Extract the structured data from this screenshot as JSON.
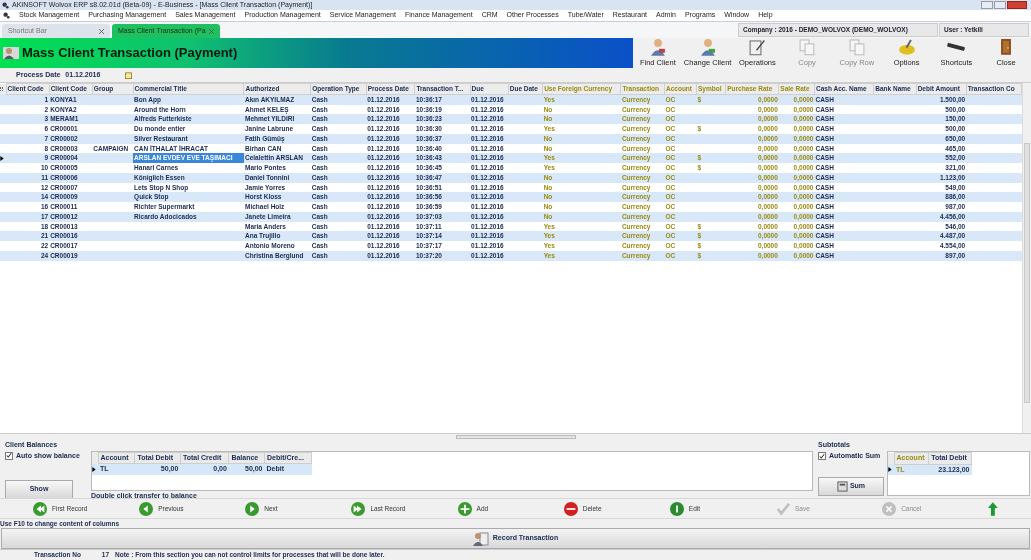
{
  "window": {
    "title": "AKINSOFT Wolvox ERP s8.02.01d (Beta-09) - E-Business - [Mass Client Transaction (Payment)]"
  },
  "menu": [
    "Stock Management",
    "Purchasing Management",
    "Sales Management",
    "Production Management",
    "Service Management",
    "Finance Management",
    "CRM",
    "Other Processes",
    "Tube/Water",
    "Restaurant",
    "Admin",
    "Programs",
    "Window",
    "Help"
  ],
  "tabs": [
    {
      "label": "Shortcut Bar",
      "selected": false
    },
    {
      "label": "Mass Client Transaction (Pa",
      "selected": true
    }
  ],
  "company": "Company : 2016 - DEMO_WOLVOX (DEMO_WOLVOX)",
  "user": "User : Yetkili",
  "form_title": "Mass Client Transaction (Payment)",
  "toolbar": [
    {
      "label": "Find Client",
      "kind": "find",
      "disabled": false
    },
    {
      "label": "Change Client",
      "kind": "change",
      "disabled": false
    },
    {
      "label": "Operations",
      "kind": "operations",
      "disabled": false
    },
    {
      "label": "Copy",
      "kind": "copy",
      "disabled": true
    },
    {
      "label": "Copy Row",
      "kind": "copyrow",
      "disabled": true
    },
    {
      "label": "Options",
      "kind": "options",
      "disabled": false
    },
    {
      "label": "Shortcuts",
      "kind": "shortcuts",
      "disabled": false
    },
    {
      "label": "Close",
      "kind": "close",
      "disabled": false
    }
  ],
  "process_date": {
    "label": "Process Date",
    "value": "01.12.2016"
  },
  "table": {
    "columns": [
      {
        "label": "Client Code",
        "highlighted": false
      },
      {
        "label": "Client Code",
        "highlighted": false
      },
      {
        "label": "Group",
        "highlighted": false
      },
      {
        "label": "Commercial Title",
        "highlighted": false
      },
      {
        "label": "Authorized",
        "highlighted": false
      },
      {
        "label": "Operation Type",
        "highlighted": false
      },
      {
        "label": "Process Date",
        "highlighted": false
      },
      {
        "label": "Transaction T...",
        "highlighted": false
      },
      {
        "label": "Due",
        "highlighted": false
      },
      {
        "label": "Due Date",
        "highlighted": false
      },
      {
        "label": "Use Foreign Currency",
        "highlighted": true
      },
      {
        "label": "Transaction",
        "highlighted": true
      },
      {
        "label": "Account",
        "highlighted": true
      },
      {
        "label": "Symbol",
        "highlighted": true
      },
      {
        "label": "Purchase Rate",
        "highlighted": true
      },
      {
        "label": "Sale Rate",
        "highlighted": true
      },
      {
        "label": "Cash Acc. Name",
        "highlighted": false
      },
      {
        "label": "Bank Name",
        "highlighted": false
      },
      {
        "label": "Debit Amount",
        "highlighted": false
      },
      {
        "label": "Transaction Co",
        "highlighted": false
      }
    ],
    "rows": [
      {
        "selected": false,
        "cells": [
          "1",
          "KONYA1",
          null,
          "Bon App",
          "Akın AKYILMAZ",
          "Cash",
          "01.12.2016",
          "10:36:17",
          "01.12.2016",
          null,
          "Yes",
          "Currency",
          "OC",
          "$",
          "0,0000",
          "0,0000",
          "CASH",
          null,
          "1.500,00",
          null
        ]
      },
      {
        "selected": false,
        "cells": [
          "2",
          "KONYA2",
          null,
          "Around the Horn",
          "Ahmet KELEŞ",
          "Cash",
          "01.12.2016",
          "10:36:19",
          "01.12.2016",
          null,
          "No",
          "Currency",
          "OC",
          null,
          "0,0000",
          "0,0000",
          "CASH",
          null,
          "500,00",
          null
        ]
      },
      {
        "selected": false,
        "cells": [
          "3",
          "MERAM1",
          null,
          "Alfreds Futterkiste",
          "Mehmet YILDIRI",
          "Cash",
          "01.12.2016",
          "10:36:23",
          "01.12.2016",
          null,
          "No",
          "Currency",
          "OC",
          null,
          "0,0000",
          "0,0000",
          "CASH",
          null,
          "150,00",
          null
        ]
      },
      {
        "selected": false,
        "cells": [
          "6",
          "CR00001",
          null,
          "Du monde entier",
          "Janine Labrune",
          "Cash",
          "01.12.2016",
          "10:36:30",
          "01.12.2016",
          null,
          "Yes",
          "Currency",
          "OC",
          "$",
          "0,0000",
          "0,0000",
          "CASH",
          null,
          "500,00",
          null
        ]
      },
      {
        "selected": false,
        "cells": [
          "7",
          "CR00002",
          null,
          "Silver Restaurant",
          "Fatih Gümüş",
          "Cash",
          "01.12.2016",
          "10:36:37",
          "01.12.2016",
          null,
          "No",
          "Currency",
          "OC",
          null,
          "0,0000",
          "0,0000",
          "CASH",
          null,
          "650,00",
          null
        ]
      },
      {
        "selected": false,
        "cells": [
          "8",
          "CR00003",
          "CAMPAIGN",
          "CAN İTHALAT İHRACAT",
          "Birhan CAN",
          "Cash",
          "01.12.2016",
          "10:36:40",
          "01.12.2016",
          null,
          "No",
          "Currency",
          "OC",
          null,
          "0,0000",
          "0,0000",
          "CASH",
          null,
          "465,00",
          null
        ]
      },
      {
        "selected": true,
        "cells": [
          "9",
          "CR00004",
          null,
          "ARSLAN EVDEV EVE TAŞIMACI",
          "Celalettin ARSLAN",
          "Cash",
          "01.12.2016",
          "10:36:43",
          "01.12.2016",
          null,
          "Yes",
          "Currency",
          "OC",
          "$",
          "0,0000",
          "0,0000",
          "CASH",
          null,
          "552,00",
          null
        ]
      },
      {
        "selected": false,
        "cells": [
          "10",
          "CR00005",
          null,
          "Hanari Carnes",
          "Mario Pontes",
          "Cash",
          "01.12.2016",
          "10:36:45",
          "01.12.2016",
          null,
          "Yes",
          "Currency",
          "OC",
          "$",
          "0,0000",
          "0,0000",
          "CASH",
          null,
          "321,00",
          null
        ]
      },
      {
        "selected": false,
        "cells": [
          "11",
          "CR00006",
          null,
          "Königlich Essen",
          "Daniel  Tonnini",
          "Cash",
          "01.12.2016",
          "10:36:47",
          "01.12.2016",
          null,
          "No",
          "Currency",
          "OC",
          null,
          "0,0000",
          "0,0000",
          "CASH",
          null,
          "1.123,00",
          null
        ]
      },
      {
        "selected": false,
        "cells": [
          "12",
          "CR00007",
          null,
          "Lets Stop N Shop",
          "Jamie  Yorres",
          "Cash",
          "01.12.2016",
          "10:36:51",
          "01.12.2016",
          null,
          "No",
          "Currency",
          "OC",
          null,
          "0,0000",
          "0,0000",
          "CASH",
          null,
          "549,00",
          null
        ]
      },
      {
        "selected": false,
        "cells": [
          "14",
          "CR00009",
          null,
          "Quick Stop",
          "Horst Kloss",
          "Cash",
          "01.12.2016",
          "10:36:56",
          "01.12.2016",
          null,
          "No",
          "Currency",
          "OC",
          null,
          "0,0000",
          "0,0000",
          "CASH",
          null,
          "886,00",
          null
        ]
      },
      {
        "selected": false,
        "cells": [
          "16",
          "CR00011",
          null,
          "Richter Supermarkt",
          "Michael Holz",
          "Cash",
          "01.12.2016",
          "10:36:59",
          "01.12.2016",
          null,
          "No",
          "Currency",
          "OC",
          null,
          "0,0000",
          "0,0000",
          "CASH",
          null,
          "987,00",
          null
        ]
      },
      {
        "selected": false,
        "cells": [
          "17",
          "CR00012",
          null,
          "Ricardo Adocicados",
          "Janete Limeira",
          "Cash",
          "01.12.2016",
          "10:37:03",
          "01.12.2016",
          null,
          "No",
          "Currency",
          "OC",
          null,
          "0,0000",
          "0,0000",
          "CASH",
          null,
          "4.456,00",
          null
        ]
      },
      {
        "selected": false,
        "cells": [
          "18",
          "CR00013",
          null,
          null,
          "Maria Anders",
          "Cash",
          "01.12.2016",
          "10:37:11",
          "01.12.2016",
          null,
          "Yes",
          "Currency",
          "OC",
          "$",
          "0,0000",
          "0,0000",
          "CASH",
          null,
          "546,00",
          null
        ]
      },
      {
        "selected": false,
        "cells": [
          "21",
          "CR00016",
          null,
          null,
          "Ana Trujillo",
          "Cash",
          "01.12.2016",
          "10:37:14",
          "01.12.2016",
          null,
          "Yes",
          "Currency",
          "OC",
          "$",
          "0,0000",
          "0,0000",
          "CASH",
          null,
          "4.487,00",
          null
        ]
      },
      {
        "selected": false,
        "cells": [
          "22",
          "CR00017",
          null,
          null,
          "Antonio  Moreno",
          "Cash",
          "01.12.2016",
          "10:37:17",
          "01.12.2016",
          null,
          "Yes",
          "Currency",
          "OC",
          "$",
          "0,0000",
          "0,0000",
          "CASH",
          null,
          "4.554,00",
          null
        ]
      },
      {
        "selected": false,
        "cells": [
          "24",
          "CR00019",
          null,
          null,
          "Christina Berglund",
          "Cash",
          "01.12.2016",
          "10:37:20",
          "01.12.2016",
          null,
          "Yes",
          "Currency",
          "OC",
          "$",
          "0,0000",
          "0,0000",
          "CASH",
          null,
          "897,00",
          null
        ]
      }
    ]
  },
  "client_balances": {
    "title": "Client Balances",
    "auto_show": {
      "label": "Auto show balance",
      "checked": true
    },
    "show_button": "Show",
    "columns": [
      {
        "label": "Account",
        "highlighted": false
      },
      {
        "label": "Total Debit",
        "highlighted": false
      },
      {
        "label": "Total Credit",
        "highlighted": false
      },
      {
        "label": "Balance",
        "highlighted": false
      },
      {
        "label": "Debit/Cre...",
        "highlighted": false
      }
    ],
    "rows": [
      [
        "TL",
        "50,00",
        "0,00",
        "50,00",
        "Debit"
      ]
    ],
    "hint": "Double click transfer to balance"
  },
  "subtotals": {
    "title": "Subtotals",
    "automatic_sum": {
      "label": "Automatic Sum",
      "checked": true
    },
    "sum_button": "Sum",
    "columns": [
      {
        "label": "Account",
        "highlighted": true
      },
      {
        "label": "Total Debit",
        "highlighted": false
      }
    ],
    "rows": [
      [
        "TL",
        "23.123,00"
      ]
    ]
  },
  "navigation": [
    {
      "label": "First Record",
      "kind": "first",
      "disabled": false
    },
    {
      "label": "Previous",
      "kind": "previous",
      "disabled": false
    },
    {
      "label": "Next",
      "kind": "next",
      "disabled": false
    },
    {
      "label": "Last Record",
      "kind": "last",
      "disabled": false
    },
    {
      "label": "Add",
      "kind": "add",
      "disabled": false
    },
    {
      "label": "Delete",
      "kind": "delete",
      "disabled": false
    },
    {
      "label": "Edit",
      "kind": "edit",
      "disabled": false
    },
    {
      "label": "Save",
      "kind": "save",
      "disabled": true
    },
    {
      "label": "Cancel",
      "kind": "cancel",
      "disabled": true
    }
  ],
  "f10_note": "Use F10 to change content of columns",
  "record_button": "Record Transaction",
  "status_bar": {
    "label": "Transaction No",
    "value": "17",
    "note": "Note : From this section you can not control limits for processes that will be done later."
  }
}
